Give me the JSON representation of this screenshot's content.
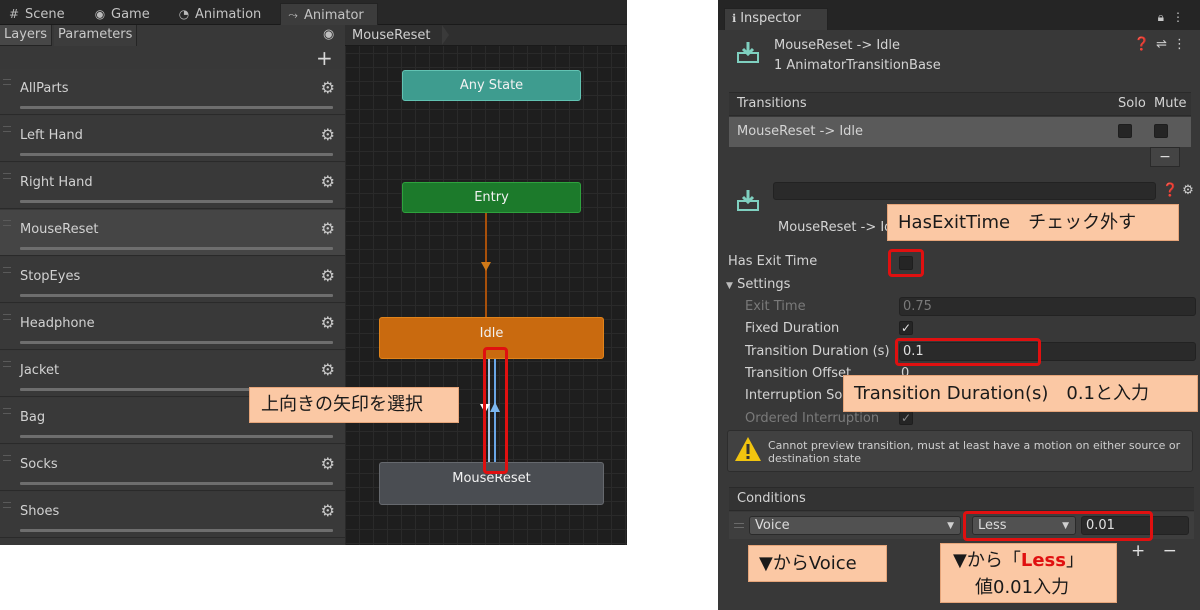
{
  "animator_window": {
    "tabs": [
      {
        "icon": "grid-icon",
        "label": "Scene"
      },
      {
        "icon": "gamepad-icon",
        "label": "Game"
      },
      {
        "icon": "clock-icon",
        "label": "Animation"
      },
      {
        "icon": "animator-icon",
        "label": "Animator"
      }
    ],
    "subtabs": [
      "Layers",
      "Parameters"
    ],
    "breadcrumb": "MouseReset",
    "layers": [
      "AllParts",
      "Left Hand",
      "Right Hand",
      "MouseReset",
      "StopEyes",
      "Headphone",
      "Jacket",
      "Bag",
      "Socks",
      "Shoes"
    ],
    "selected_layer": "MouseReset",
    "states": {
      "any": "Any State",
      "entry": "Entry",
      "idle": "Idle",
      "mousereset": "MouseReset"
    },
    "colors": {
      "any": "#3e9c8f",
      "entry": "#1c7a2b",
      "idle": "#c96a0f",
      "mousereset": "#4a4d52"
    }
  },
  "annotations": {
    "select_arrow": "上向きの矢印を選択",
    "has_exit_time": "HasExitTime　チェック外す",
    "transition_duration": "Transition Duration(s)　0.1と入力",
    "voice": "▼からVoice",
    "less_prefix": "▼から「",
    "less_word": "Less",
    "less_suffix": "」",
    "less_line2": "値0.01入力"
  },
  "inspector": {
    "tab_label": "Inspector",
    "header_title": "MouseReset -> Idle",
    "header_subtitle": "1 AnimatorTransitionBase",
    "transitions_label": "Transitions",
    "solo_label": "Solo",
    "mute_label": "Mute",
    "transition_item": "MouseReset -> Idle",
    "minus": "−",
    "transition_name_value": "",
    "transition_subtitle": "MouseReset -> Id",
    "has_exit_time_label": "Has Exit Time",
    "has_exit_time_checked": false,
    "settings_label": "Settings",
    "exit_time_label": "Exit Time",
    "exit_time_value": "0.75",
    "fixed_duration_label": "Fixed Duration",
    "fixed_duration_checked": true,
    "transition_duration_label": "Transition Duration (s)",
    "transition_duration_value": "0.1",
    "transition_offset_label": "Transition Offset",
    "transition_offset_value": "0",
    "interruption_source_label": "Interruption Sou",
    "ordered_interruption_label": "Ordered Interruption",
    "ordered_interruption_checked": true,
    "warning_text_line1": "Cannot preview transition, must at least have a motion on either source or",
    "warning_text_line2": "destination state",
    "conditions_label": "Conditions",
    "condition": {
      "parameter": "Voice",
      "mode": "Less",
      "value": "0.01"
    },
    "plus": "+",
    "accent": "#e01010"
  }
}
